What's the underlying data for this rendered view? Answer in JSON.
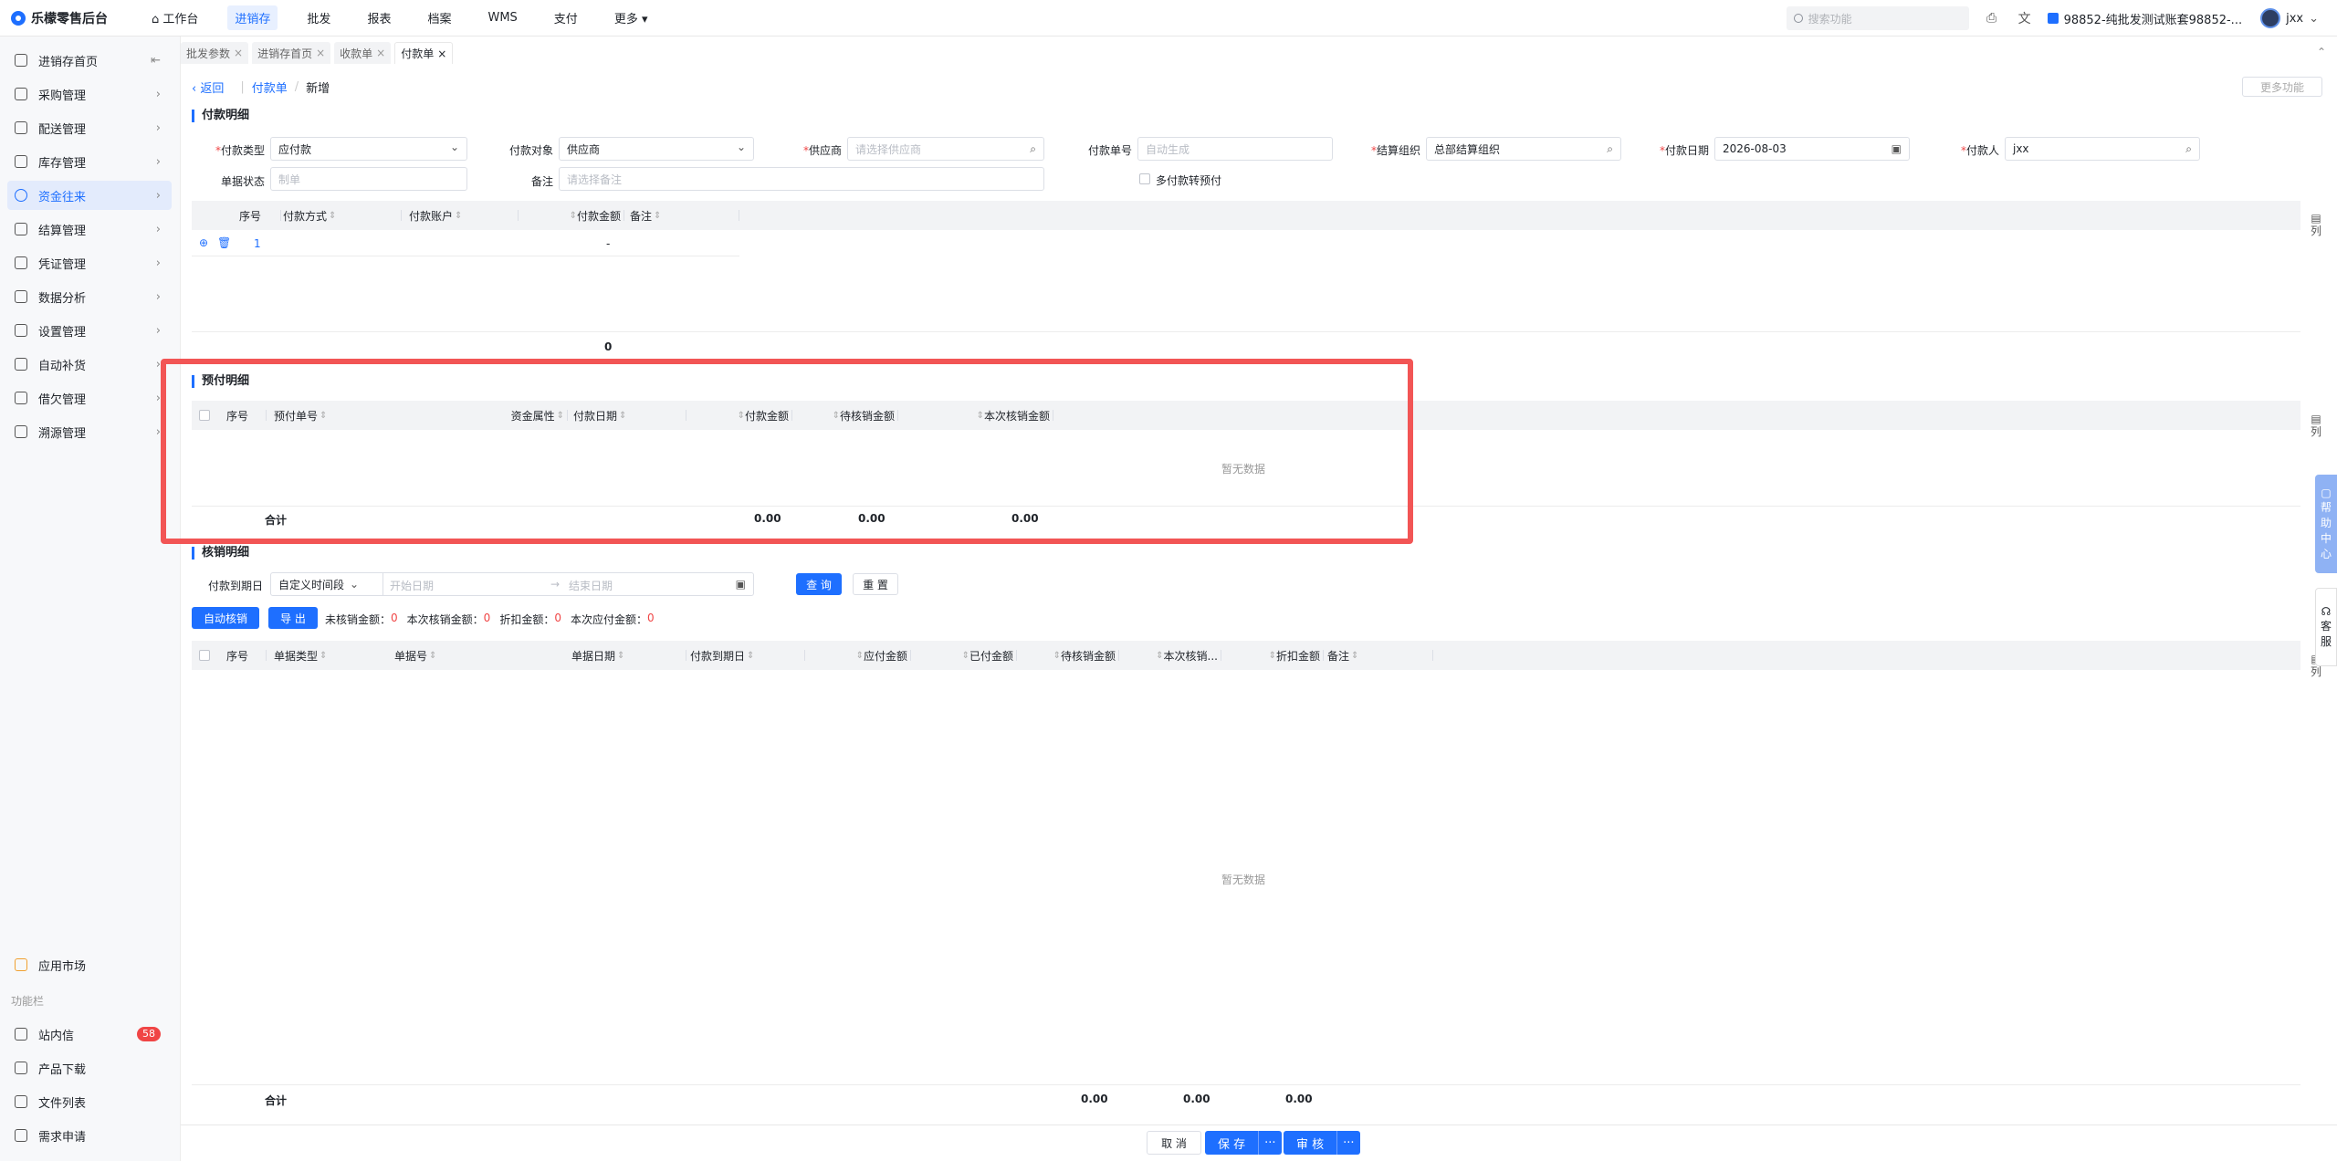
{
  "app": {
    "title": "乐檬零售后台"
  },
  "nav": {
    "items": [
      "工作台",
      "进销存",
      "批发",
      "报表",
      "档案",
      "WMS",
      "支付",
      "更多"
    ]
  },
  "topbar": {
    "search_placeholder": "搜索功能",
    "account": "98852-纯批发测试账套98852-...",
    "user": "jxx"
  },
  "sidebar": {
    "collapse_icon": "collapse-icon",
    "items": [
      "进销存首页",
      "采购管理",
      "配送管理",
      "库存管理",
      "资金往来",
      "结算管理",
      "凭证管理",
      "数据分析",
      "设置管理",
      "自动补货",
      "借欠管理",
      "溯源管理"
    ],
    "active_index": 4,
    "app_market": "应用市场",
    "section_label": "功能栏",
    "bottom": [
      "站内信",
      "产品下载",
      "文件列表",
      "需求申请"
    ],
    "message_count": "58"
  },
  "tabs": [
    "批发参数",
    "进销存首页",
    "收款单",
    "付款单"
  ],
  "active_tab": 3,
  "breadcrumb": {
    "back": "返回",
    "parent": "付款单",
    "current": "新增"
  },
  "more_functions": "更多功能",
  "payment_detail": {
    "title": "付款明细",
    "form": {
      "pay_type": {
        "label": "付款类型",
        "value": "应付款"
      },
      "pay_target": {
        "label": "付款对象",
        "value": "供应商"
      },
      "supplier": {
        "label": "供应商",
        "placeholder": "请选择供应商"
      },
      "pay_no": {
        "label": "付款单号",
        "placeholder": "自动生成"
      },
      "settle_org": {
        "label": "结算组织",
        "value": "总部结算组织"
      },
      "pay_date": {
        "label": "付款日期",
        "value": "2026-08-03"
      },
      "payer": {
        "label": "付款人",
        "value": "jxx"
      },
      "doc_status": {
        "label": "单据状态",
        "placeholder": "制单"
      },
      "remark": {
        "label": "备注",
        "placeholder": "请选择备注"
      },
      "multi_prepay": "多付款转预付"
    },
    "columns": [
      "序号",
      "付款方式",
      "付款账户",
      "付款金额",
      "备注"
    ],
    "rows": [
      {
        "no": "1",
        "amount": "-"
      }
    ],
    "total": "0",
    "col_btn": "列"
  },
  "prepay_detail": {
    "title": "预付明细",
    "columns": [
      "序号",
      "预付单号",
      "资金属性",
      "付款日期",
      "付款金额",
      "待核销金额",
      "本次核销金额"
    ],
    "empty": "暂无数据",
    "total_label": "合计",
    "totals": [
      "0.00",
      "0.00",
      "0.00"
    ],
    "col_btn": "列"
  },
  "verify_detail": {
    "title": "核销明细",
    "date_label": "付款到期日",
    "date_mode": "自定义时间段",
    "start_placeholder": "开始日期",
    "end_placeholder": "结束日期",
    "query": "查 询",
    "reset": "重 置",
    "auto_verify": "自动核销",
    "export": "导 出",
    "summary": [
      {
        "label": "未核销金额：",
        "value": "0"
      },
      {
        "label": "本次核销金额：",
        "value": "0"
      },
      {
        "label": "折扣金额：",
        "value": "0"
      },
      {
        "label": "本次应付金额：",
        "value": "0"
      }
    ],
    "columns": [
      "序号",
      "单据类型",
      "单据号",
      "单据日期",
      "付款到期日",
      "应付金额",
      "已付金额",
      "待核销金额",
      "本次核销...",
      "折扣金额",
      "备注"
    ],
    "empty": "暂无数据",
    "total_label": "合计",
    "totals": [
      "0.00",
      "0.00",
      "0.00"
    ],
    "col_btn": "列"
  },
  "floats": {
    "help": [
      "帮",
      "助",
      "中",
      "心"
    ],
    "service": [
      "客",
      "服"
    ]
  },
  "footer": {
    "cancel": "取 消",
    "save": "保 存",
    "audit": "审 核",
    "more": "···"
  },
  "colors": {
    "accent": "#1e6fff",
    "danger": "#f04545",
    "highlight": "#f25555"
  }
}
